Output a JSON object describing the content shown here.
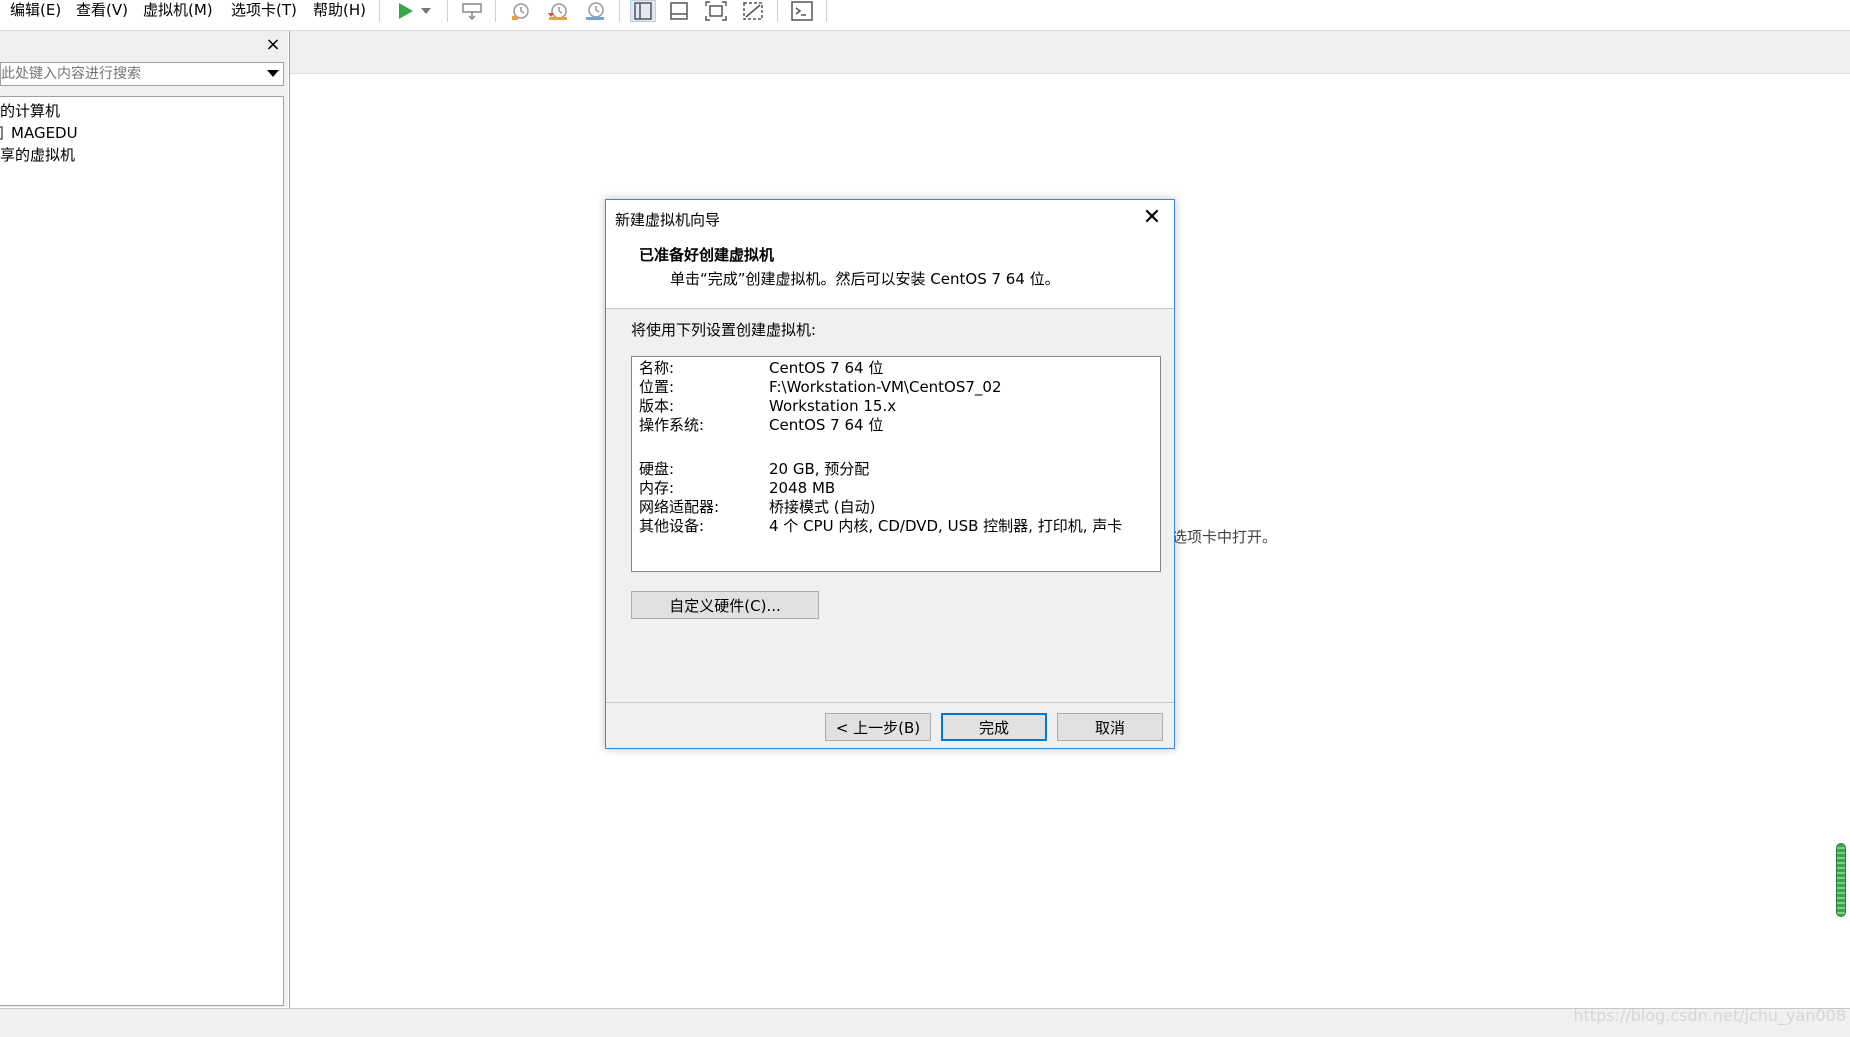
{
  "menubar": {
    "items": [
      "编辑(E)",
      "查看(V)",
      "虚拟机(M)",
      "选项卡(T)",
      "帮助(H)"
    ]
  },
  "toolbar": {
    "icons": [
      "play-icon",
      "dropdown-arrow-icon",
      "send-keys-icon",
      "snapshot-icon",
      "revert-snapshot-icon",
      "snapshot-manager-icon",
      "library-view-icon",
      "thumbnail-bar-icon",
      "fullscreen-icon",
      "unity-icon",
      "console-icon"
    ],
    "accent": "#3aa64a"
  },
  "sidebar": {
    "close_glyph": "×",
    "search_placeholder": "在此处键入内容进行搜索",
    "tree": [
      {
        "label": "我的计算机"
      },
      {
        "label": "MAGEDU"
      },
      {
        "label": "共享的虚拟机"
      }
    ]
  },
  "main": {
    "background_hint": "选项卡中打开。"
  },
  "dialog": {
    "title": "新建虚拟机向导",
    "close_glyph": "✕",
    "heading": "已准备好创建虚拟机",
    "subheading": "单击“完成”创建虚拟机。然后可以安装 CentOS 7 64 位。",
    "intro": "将使用下列设置创建虚拟机:",
    "summary": [
      {
        "label": "名称:",
        "value": "CentOS 7 64 位"
      },
      {
        "label": "位置:",
        "value": "F:\\Workstation-VM\\CentOS7_02"
      },
      {
        "label": "版本:",
        "value": "Workstation 15.x"
      },
      {
        "label": "操作系统:",
        "value": "CentOS 7 64 位"
      },
      {
        "label": "硬盘:",
        "value": "20 GB, 预分配"
      },
      {
        "label": "内存:",
        "value": "2048 MB"
      },
      {
        "label": "网络适配器:",
        "value": "桥接模式 (自动)"
      },
      {
        "label": "其他设备:",
        "value": "4 个 CPU 内核, CD/DVD, USB 控制器, 打印机, 声卡"
      }
    ],
    "customize_label": "自定义硬件(C)...",
    "back_label": "< 上一步(B)",
    "finish_label": "完成",
    "cancel_label": "取消",
    "border_color": "#3c8ad2"
  },
  "watermark": "https://blog.csdn.net/jchu_yan008"
}
